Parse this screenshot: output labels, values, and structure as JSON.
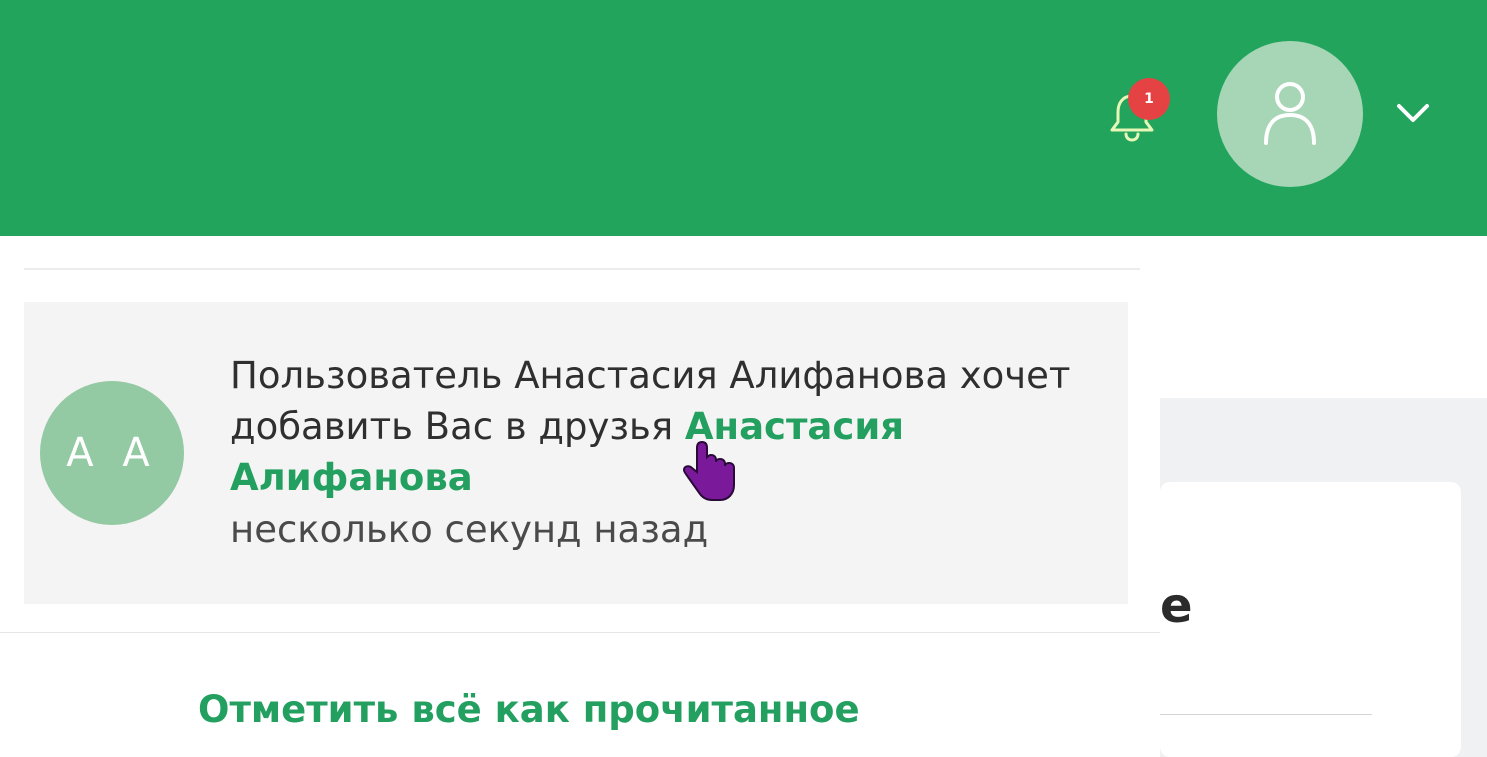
{
  "header": {
    "background_color": "#22a45d",
    "notifications": {
      "icon": "bell-icon",
      "unread_count": "1",
      "badge_color": "#e54343"
    },
    "user_menu": {
      "avatar_icon": "user-icon",
      "dropdown_icon": "chevron-down-icon"
    }
  },
  "notifications_dropdown": {
    "items": [
      {
        "avatar_initials": "A A",
        "message": "Пользователь Анастасия Алифанова хочет добавить Вас в друзья",
        "name_link": "Анастасия Алифанова",
        "time": "несколько секунд назад"
      }
    ],
    "mark_all_read_label": "Отметить всё как прочитанное"
  },
  "background_page": {
    "partial_heading": "е"
  },
  "colors": {
    "accent": "#23a060",
    "avatar_bg": "#93c9a3"
  }
}
